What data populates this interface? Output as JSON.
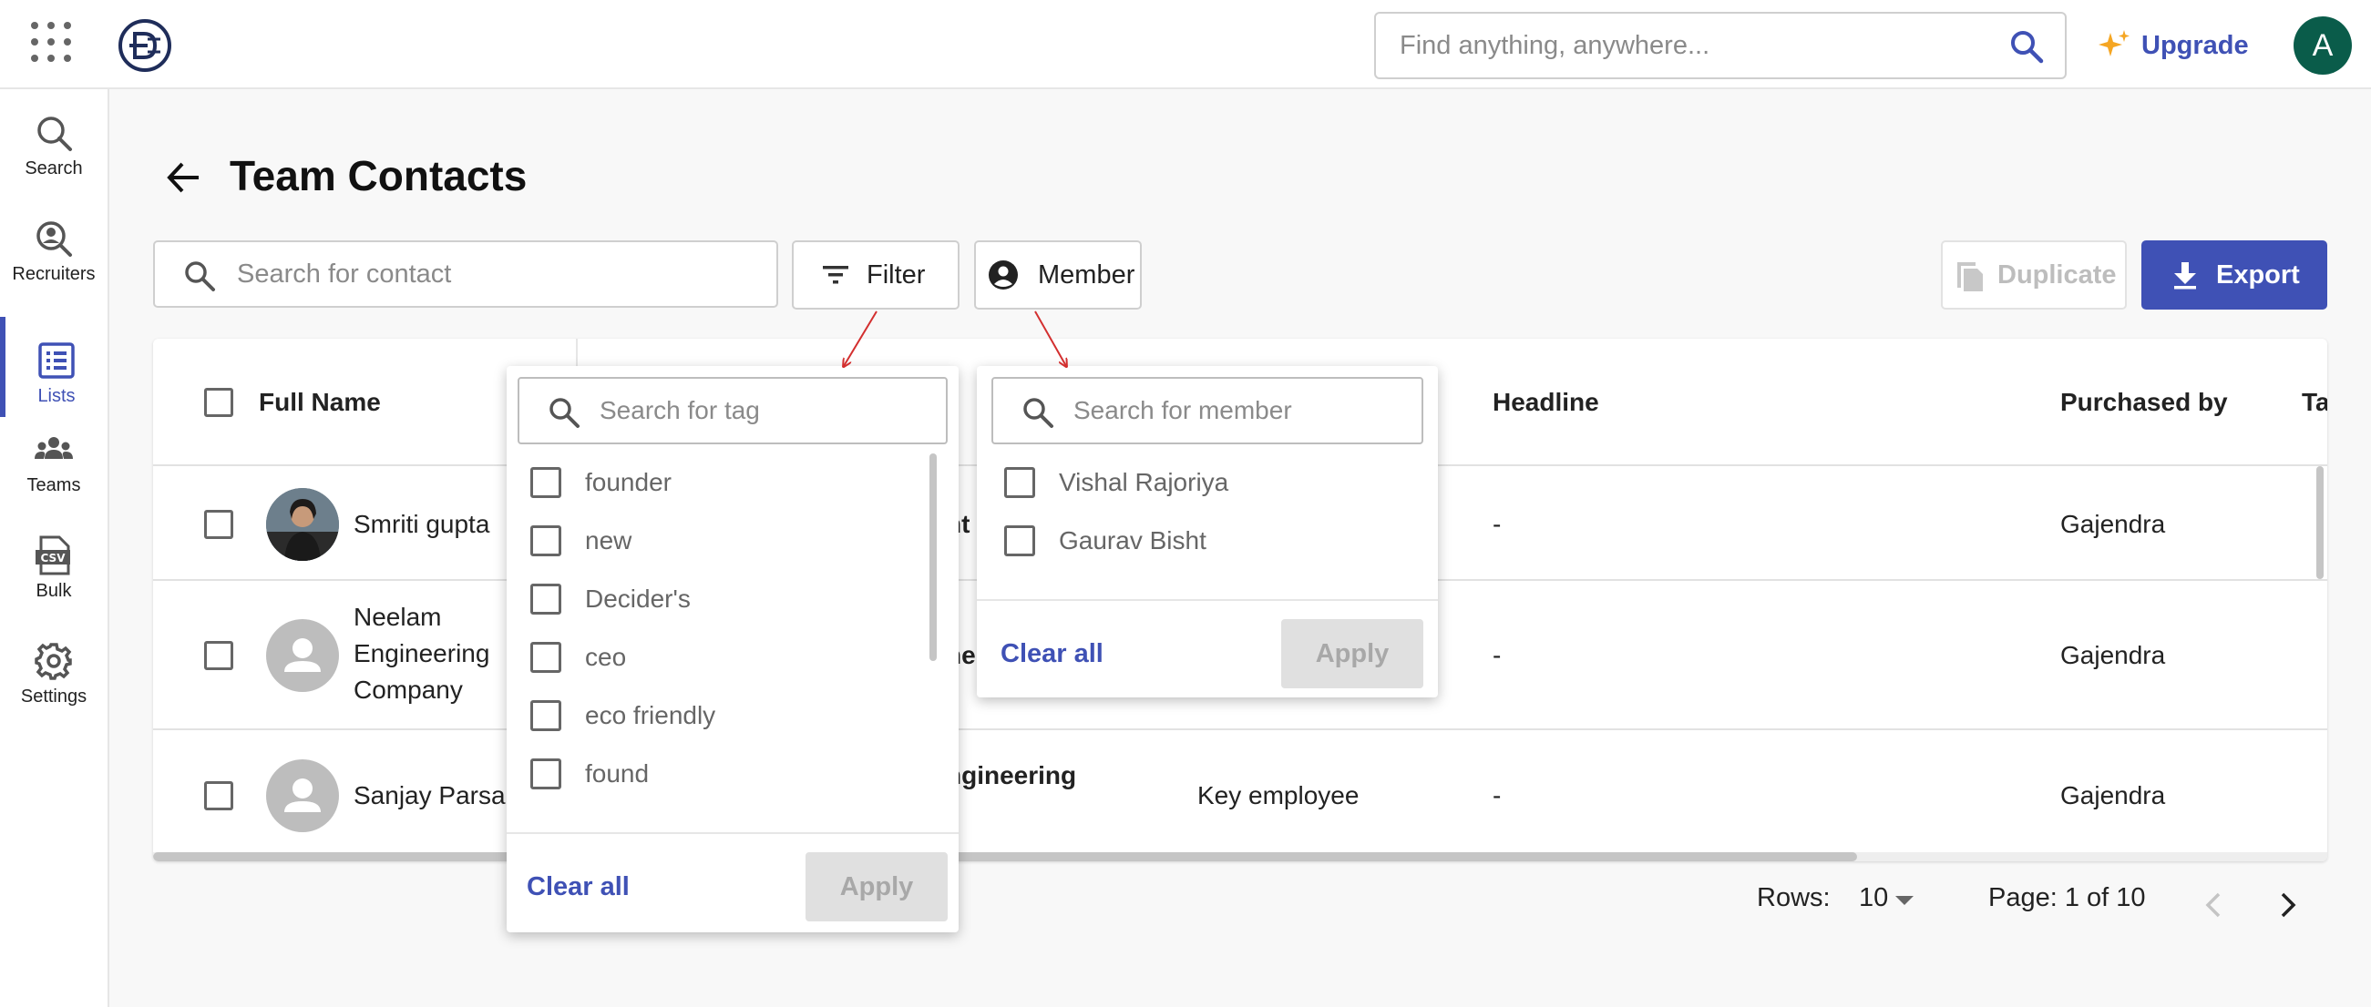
{
  "topbar": {
    "search_placeholder": "Find anything, anywhere...",
    "upgrade_label": "Upgrade",
    "avatar_initial": "A"
  },
  "sidebar": {
    "items": [
      {
        "label": "Search",
        "icon": "search-icon"
      },
      {
        "label": "Recruiters",
        "icon": "recruiter-search-icon"
      },
      {
        "label": "Lists",
        "icon": "list-icon",
        "active": true
      },
      {
        "label": "Teams",
        "icon": "groups-icon"
      },
      {
        "label": "Bulk",
        "icon": "csv-file-icon"
      },
      {
        "label": "Settings",
        "icon": "gear-icon"
      }
    ]
  },
  "page": {
    "title": "Team Contacts"
  },
  "toolbar": {
    "contact_search_placeholder": "Search for contact",
    "filter_label": "Filter",
    "member_label": "Member",
    "duplicate_label": "Duplicate",
    "export_label": "Export"
  },
  "table": {
    "headers": {
      "full_name": "Full Name",
      "headline": "Headline",
      "purchased_by": "Purchased by",
      "tags_partial": "Ta"
    },
    "rows": [
      {
        "name": "Smriti gupta",
        "company_fragment": "nt",
        "headline": "-",
        "purchased_by": "Gajendra"
      },
      {
        "name_lines": [
          "Neelam",
          "Engineering",
          "Company"
        ],
        "company_fragment": "ne",
        "headline": "-",
        "purchased_by": "Gajendra"
      },
      {
        "name": "Sanjay Parsa",
        "company_fragment": "ngineering",
        "title": "Key employee",
        "headline": "-",
        "purchased_by": "Gajendra"
      }
    ]
  },
  "filter_panel": {
    "search_placeholder": "Search for tag",
    "options": [
      "founder",
      "new",
      "Decider's",
      "ceo",
      "eco friendly",
      "found"
    ],
    "clear_label": "Clear all",
    "apply_label": "Apply"
  },
  "member_panel": {
    "search_placeholder": "Search for member",
    "options": [
      "Vishal Rajoriya",
      "Gaurav Bisht"
    ],
    "clear_label": "Clear all",
    "apply_label": "Apply"
  },
  "pagination": {
    "rows_label": "Rows:",
    "rows_value": "10",
    "page_label": "Page: 1 of 10"
  },
  "colors": {
    "accent": "#3f51b5",
    "avatar_bg": "#0a5c4a",
    "upgrade_star": "#f5a623",
    "annotation_arrow": "#d32f2f"
  }
}
